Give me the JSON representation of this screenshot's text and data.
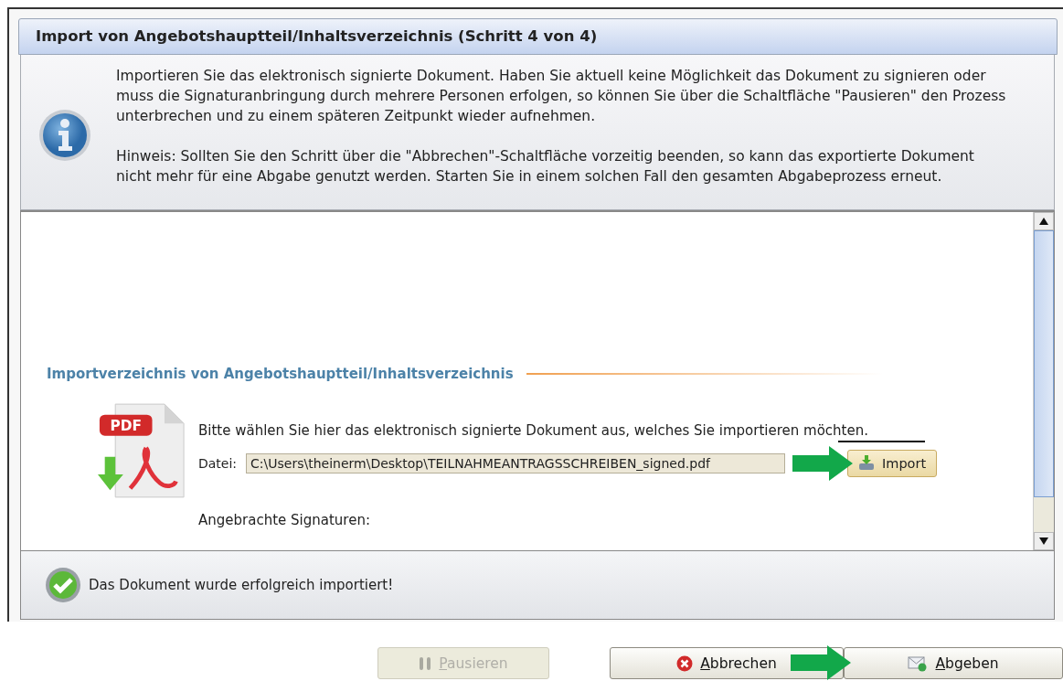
{
  "dialog": {
    "title": "Import von Angebotshauptteil/Inhaltsverzeichnis (Schritt 4 von 4)"
  },
  "info": {
    "paragraphs": [
      "Importieren Sie das elektronisch signierte Dokument. Haben Sie aktuell keine Möglichkeit das Dokument zu signieren oder muss die Signaturanbringung durch mehrere Personen erfolgen, so können Sie über die Schaltfläche \"Pausieren\" den Prozess unterbrechen und zu einem späteren Zeitpunkt wieder aufnehmen.",
      "Hinweis: Sollten Sie den Schritt über die \"Abbrechen\"-Schaltfläche vorzeitig beenden, so kann das exportierte Dokument nicht mehr für eine Abgabe genutzt werden. Starten Sie in einem solchen Fall den gesamten Abgabeprozess erneut."
    ]
  },
  "section": {
    "heading": "Importverzeichnis von Angebotshauptteil/Inhaltsverzeichnis",
    "pdf_badge": "PDF",
    "instruction": "Bitte wählen Sie hier das elektronisch signierte Dokument aus, welches Sie importieren möchten.",
    "file_label": "Datei:",
    "file_value": "C:\\Users\\theinerm\\Desktop\\TEILNAHMEANTRAGSSCHREIBEN_signed.pdf",
    "import_button": "Import",
    "signatures_label": "Angebrachte Signaturen:"
  },
  "status": {
    "message": "Das Dokument wurde erfolgreich importiert!"
  },
  "buttons": [
    {
      "kind": "pause",
      "label": "Pausieren",
      "disabled": true
    },
    {
      "kind": "cancel",
      "label": "Abbrechen",
      "disabled": false
    },
    {
      "kind": "submit",
      "label": "Abgeben",
      "disabled": false
    }
  ]
}
